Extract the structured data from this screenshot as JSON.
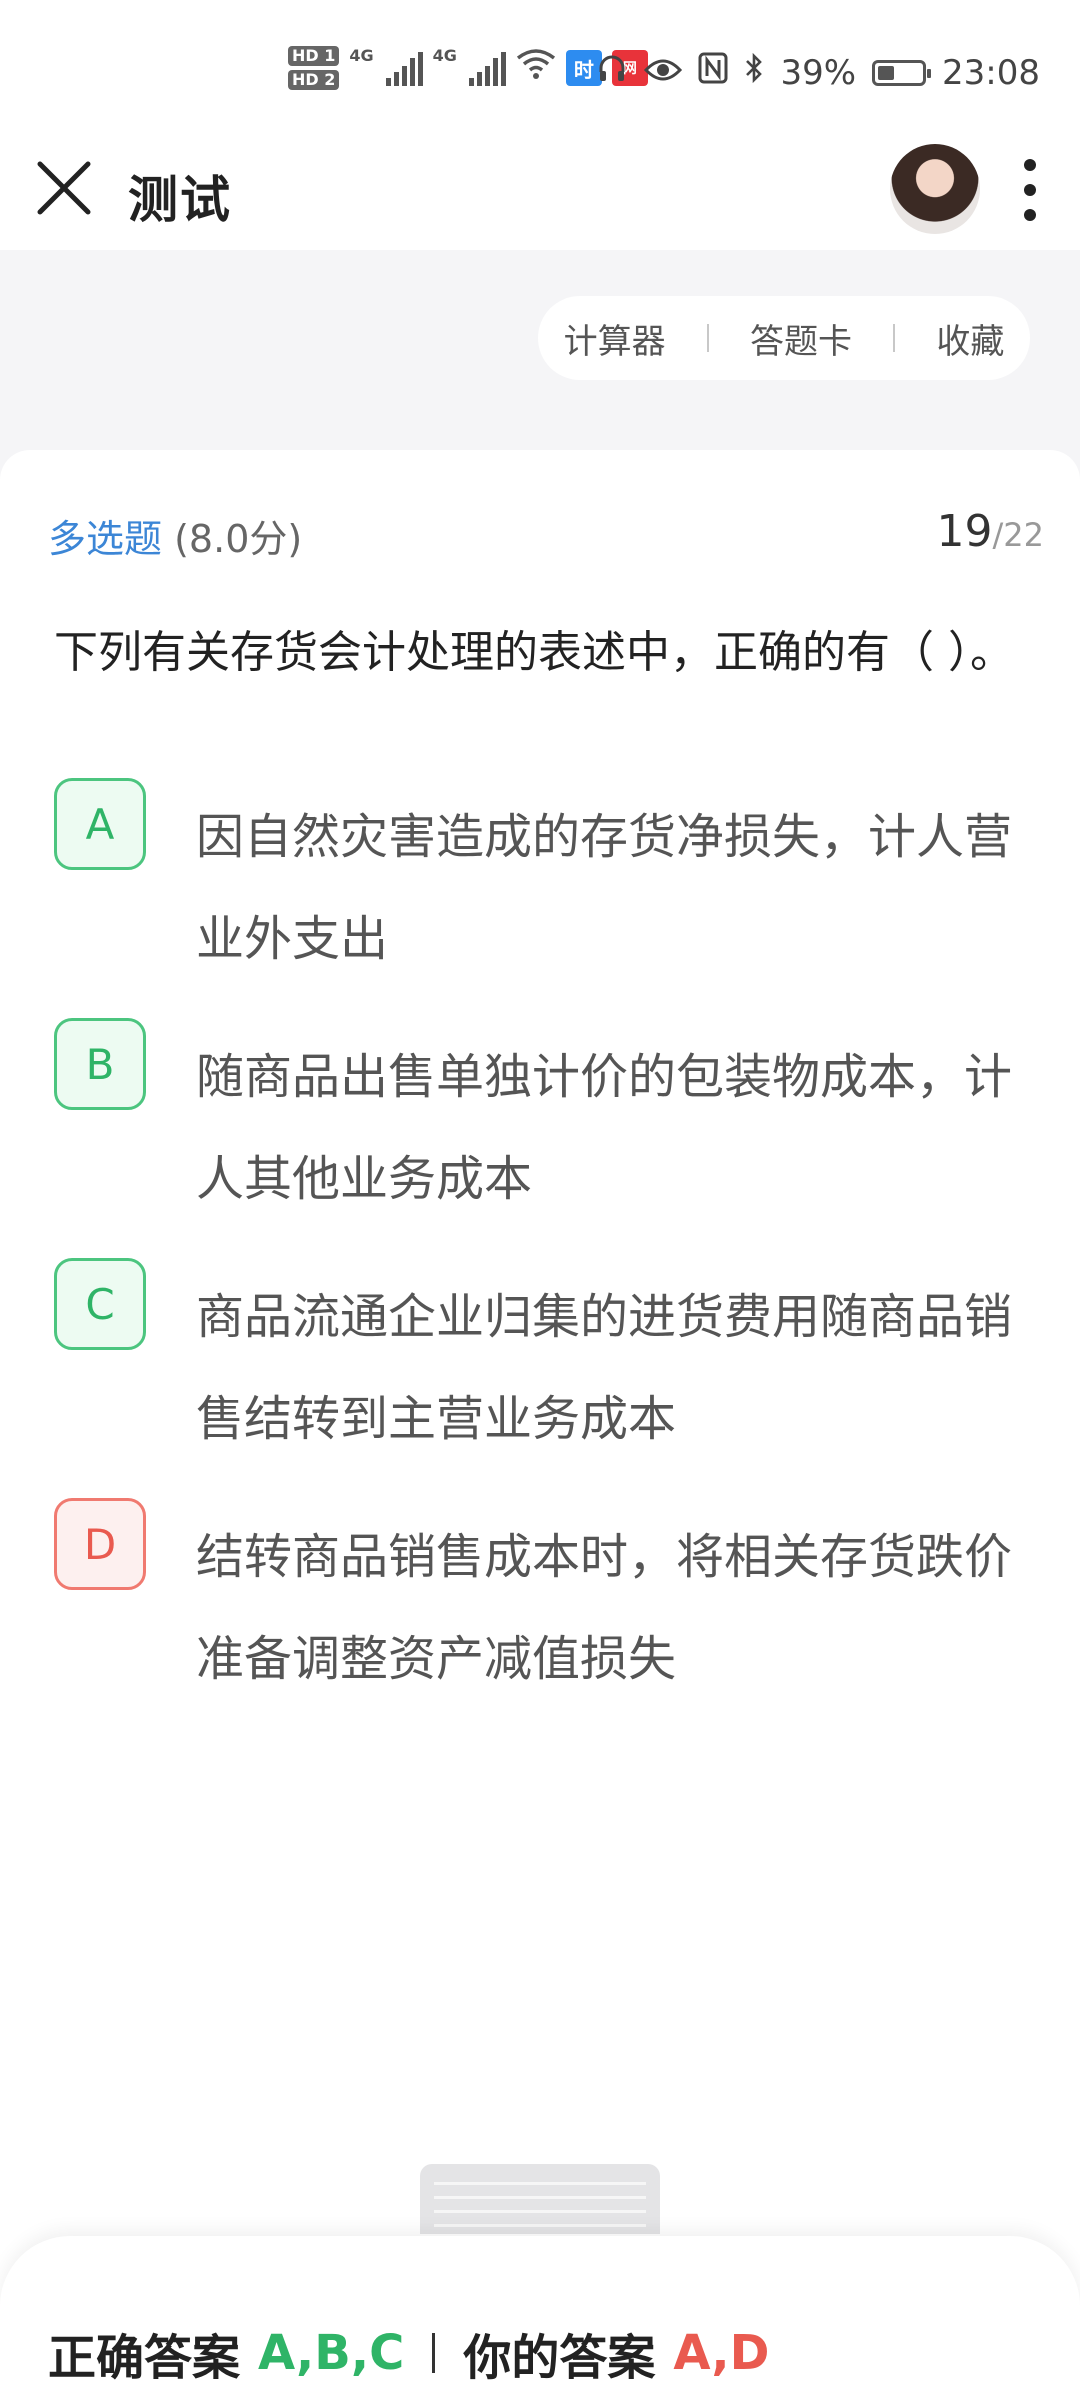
{
  "status_bar": {
    "hd1": "HD",
    "hd1_sub": "1",
    "hd2": "HD",
    "hd2_sub": "2",
    "net1": "4G",
    "net2": "4G",
    "app_badge_1": "时",
    "app_badge_2": "网",
    "battery_text": "39%",
    "battery_level": 0.39,
    "time": "23:08",
    "colors": {
      "badge_blue": "#2d8cf0",
      "badge_red": "#e8333a"
    }
  },
  "header": {
    "title": "测试",
    "close_icon": "close-icon",
    "more_icon": "more-vertical-icon"
  },
  "tools": {
    "calculator": "计算器",
    "answer_card": "答题卡",
    "favorite": "收藏"
  },
  "question": {
    "type": "多选题",
    "score": "(8.0分)",
    "current": "19",
    "total": "/22",
    "text": "下列有关存货会计处理的表述中，正确的有（ ）。",
    "options": [
      {
        "letter": "A",
        "text": "因自然灾害造成的存货净损失，计人营业外支出",
        "state": "correct"
      },
      {
        "letter": "B",
        "text": "随商品出售单独计价的包装物成本，计人其他业务成本",
        "state": "correct"
      },
      {
        "letter": "C",
        "text": "商品流通企业归集的进货费用随商品销售结转到主营业务成本",
        "state": "correct"
      },
      {
        "letter": "D",
        "text": "结转商品销售成本时，将相关存货跌价准备调整资产减值损失",
        "state": "wrong"
      }
    ]
  },
  "result": {
    "correct_label": "正确答案",
    "correct_value": "A,B,C",
    "your_label": "你的答案",
    "your_value": "A,D",
    "colors": {
      "correct": "#2fb467",
      "wrong": "#e95a4f"
    }
  }
}
